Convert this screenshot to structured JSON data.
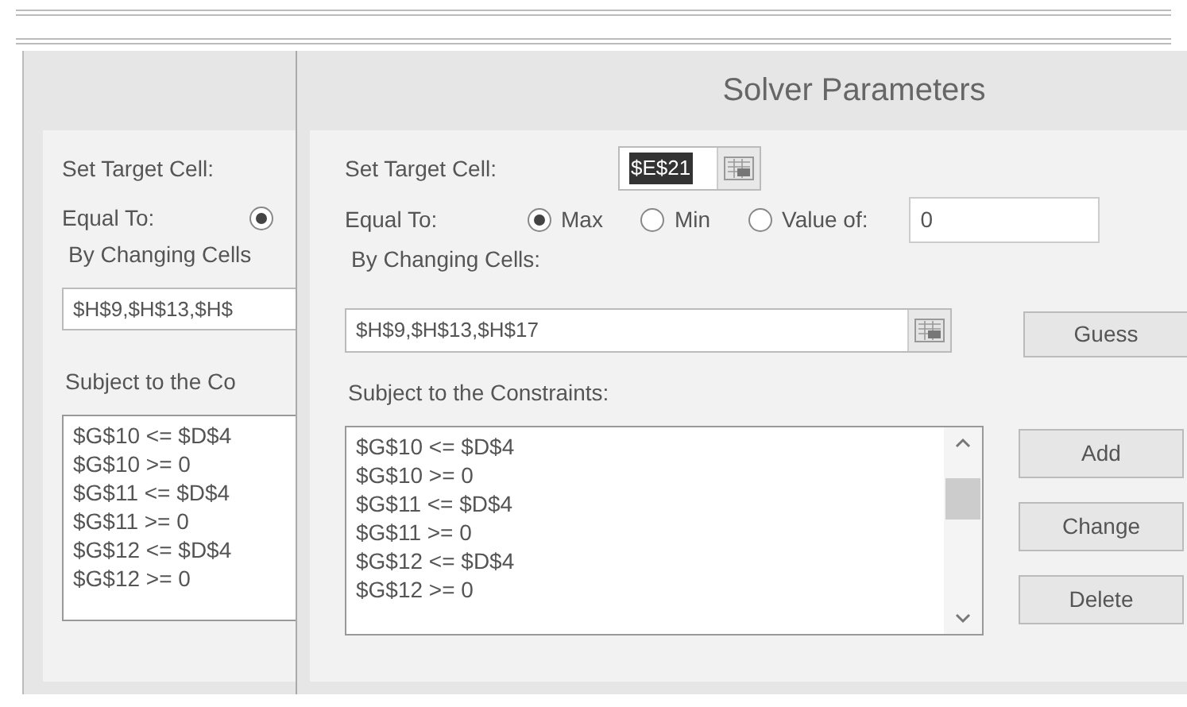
{
  "back_dialog": {
    "target_label": "Set Target Cell:",
    "equal_to_label": "Equal To:",
    "radio": {
      "selected": true
    },
    "changing_label": "By Changing Cells",
    "changing_value": "$H$9,$H$13,$H$",
    "constraints_label": "Subject to the Co",
    "constraints": [
      "$G$10 <= $D$4",
      "$G$10 >= 0",
      "$G$11 <= $D$4",
      "$G$11 >= 0",
      "$G$12 <= $D$4",
      "$G$12 >= 0"
    ]
  },
  "dialog": {
    "title": "Solver Parameters",
    "target_label": "Set Target Cell:",
    "target_value": "$E$21",
    "target_selected": true,
    "equal_to_label": "Equal To:",
    "options": [
      {
        "label": "Max",
        "selected": true
      },
      {
        "label": "Min",
        "selected": false
      },
      {
        "label": "Value of:",
        "selected": false
      }
    ],
    "value_of": "0",
    "changing_label": "By Changing Cells:",
    "changing_value": "$H$9,$H$13,$H$17",
    "guess_button": "Guess",
    "constraints_label": "Subject to the Constraints:",
    "constraints": [
      "$G$10 <= $D$4",
      "$G$10 >= 0",
      "$G$11 <= $D$4",
      "$G$11 >= 0",
      "$G$12 <= $D$4",
      "$G$12 >= 0"
    ],
    "buttons": [
      "Add",
      "Change",
      "Delete"
    ]
  }
}
